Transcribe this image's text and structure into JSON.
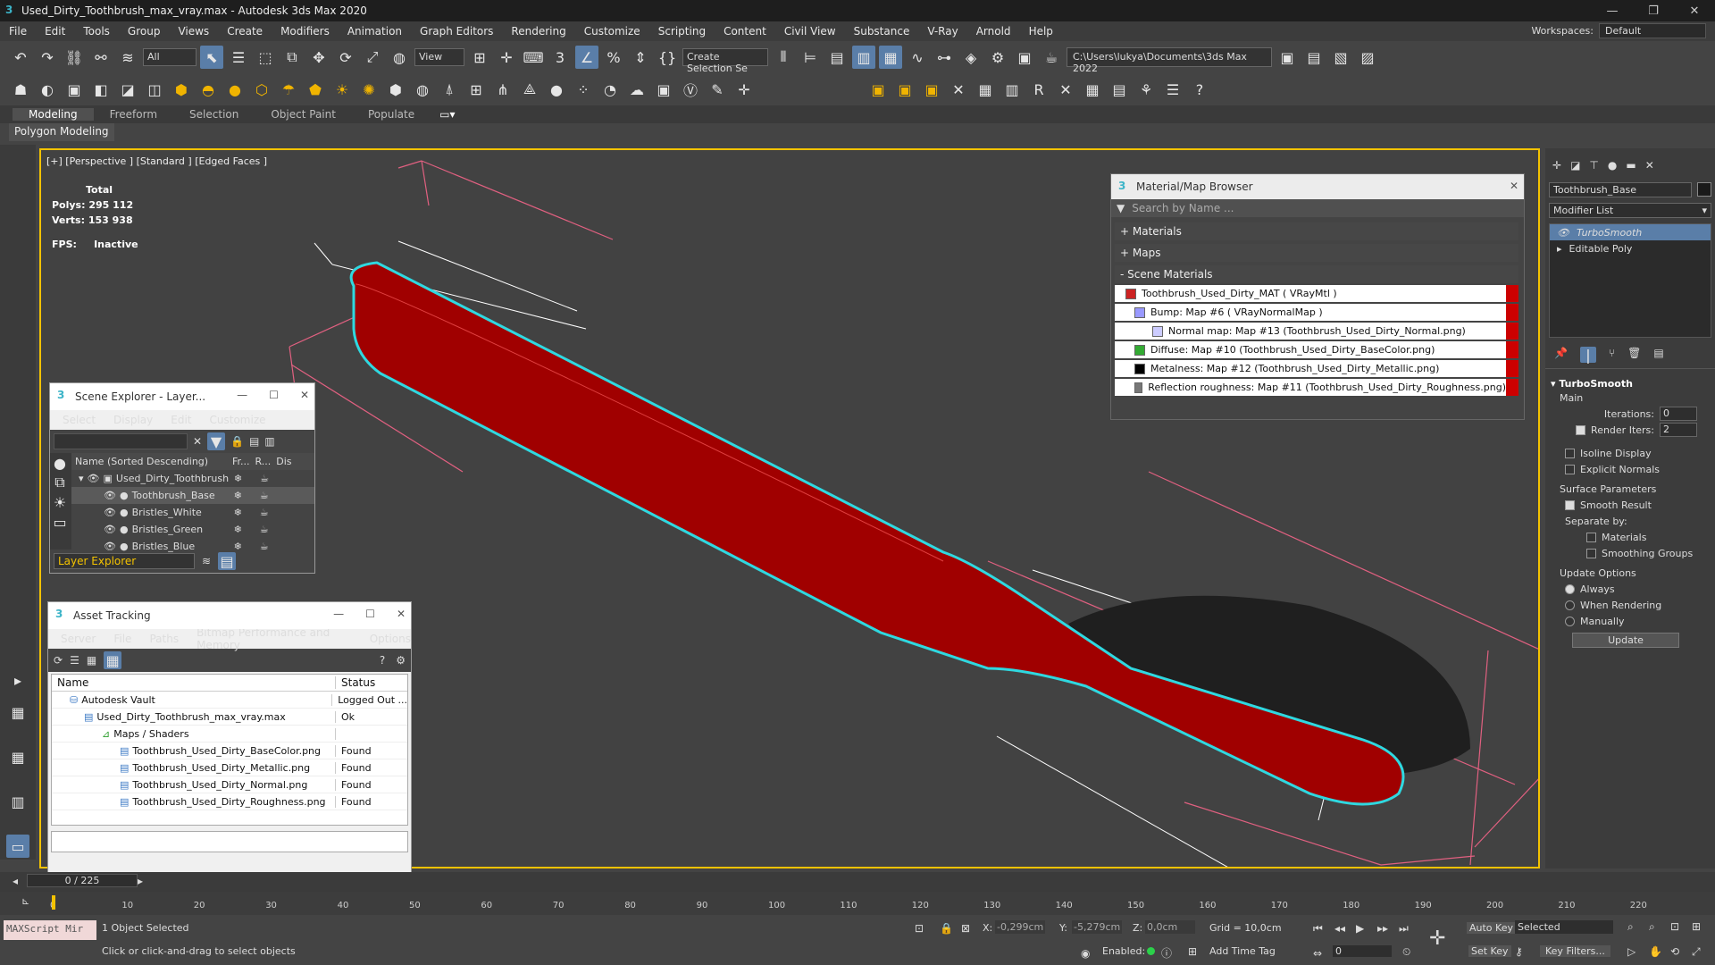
{
  "app": {
    "title": "Used_Dirty_Toothbrush_max_vray.max - Autodesk 3ds Max 2020"
  },
  "menu": [
    "File",
    "Edit",
    "Tools",
    "Group",
    "Views",
    "Create",
    "Modifiers",
    "Animation",
    "Graph Editors",
    "Rendering",
    "Customize",
    "Scripting",
    "Content",
    "Civil View",
    "Substance",
    "V-Ray",
    "Arnold",
    "Help"
  ],
  "workspace": {
    "label": "Workspaces:",
    "value": "Default"
  },
  "toolbar": {
    "filter": "All",
    "view": "View",
    "selection_set": "Create Selection Se",
    "path": "C:\\Users\\lukya\\Documents\\3ds Max 2022"
  },
  "ribbon": {
    "tabs": [
      "Modeling",
      "Freeform",
      "Selection",
      "Object Paint",
      "Populate"
    ],
    "sub": "Polygon Modeling"
  },
  "viewport": {
    "label": "[+] [Perspective ] [Standard ] [Edged Faces ]",
    "total": "Total",
    "polys_label": "Polys:",
    "polys": "295 112",
    "verts_label": "Verts:",
    "verts": "153 938",
    "fps_label": "FPS:",
    "fps": "Inactive"
  },
  "scene_explorer": {
    "title": "Scene Explorer - Layer...",
    "menu": [
      "Select",
      "Display",
      "Edit",
      "Customize"
    ],
    "col_name": "Name (Sorted Descending)",
    "col_fr": "Fr...",
    "col_r": "R...",
    "col_dis": "Dis",
    "items": [
      "Used_Dirty_Toothbrush",
      "Toothbrush_Base",
      "Bristles_White",
      "Bristles_Green",
      "Bristles_Blue"
    ],
    "footer": "Layer Explorer"
  },
  "asset_tracking": {
    "title": "Asset Tracking",
    "menu": [
      "Server",
      "File",
      "Paths",
      "Bitmap Performance and Memory",
      "Options"
    ],
    "col_name": "Name",
    "col_status": "Status",
    "rows": [
      {
        "name": "Autodesk Vault",
        "status": "Logged Out ..."
      },
      {
        "name": "Used_Dirty_Toothbrush_max_vray.max",
        "status": "Ok"
      },
      {
        "name": "Maps / Shaders",
        "status": ""
      },
      {
        "name": "Toothbrush_Used_Dirty_BaseColor.png",
        "status": "Found"
      },
      {
        "name": "Toothbrush_Used_Dirty_Metallic.png",
        "status": "Found"
      },
      {
        "name": "Toothbrush_Used_Dirty_Normal.png",
        "status": "Found"
      },
      {
        "name": "Toothbrush_Used_Dirty_Roughness.png",
        "status": "Found"
      }
    ]
  },
  "material_browser": {
    "title": "Material/Map Browser",
    "search": "Search by Name ...",
    "sections": [
      "+ Materials",
      "+ Maps",
      "- Scene Materials"
    ],
    "items": [
      "Toothbrush_Used_Dirty_MAT ( VRayMtl )",
      "Bump: Map #6  ( VRayNormalMap )",
      "Normal map: Map #13 (Toothbrush_Used_Dirty_Normal.png)",
      "Diffuse: Map #10 (Toothbrush_Used_Dirty_BaseColor.png)",
      "Metalness: Map #12 (Toothbrush_Used_Dirty_Metallic.png)",
      "Reflection roughness: Map #11 (Toothbrush_Used_Dirty_Roughness.png)"
    ]
  },
  "command_panel": {
    "object_name": "Toothbrush_Base",
    "modifier_list": "Modifier List",
    "stack": [
      "TurboSmooth",
      "Editable Poly"
    ],
    "rollout": "TurboSmooth",
    "main": "Main",
    "iterations_label": "Iterations:",
    "iterations": "0",
    "render_iters_label": "Render Iters:",
    "render_iters": "2",
    "isoline": "Isoline Display",
    "explicit_normals": "Explicit Normals",
    "surface_params": "Surface Parameters",
    "smooth_result": "Smooth Result",
    "separate_by": "Separate by:",
    "materials": "Materials",
    "smoothing_groups": "Smoothing Groups",
    "update_options": "Update Options",
    "always": "Always",
    "when_rendering": "When Rendering",
    "manually": "Manually",
    "update": "Update"
  },
  "timeline": {
    "frame": "0 / 225",
    "ticks": [
      "0",
      "10",
      "20",
      "30",
      "40",
      "50",
      "60",
      "70",
      "80",
      "90",
      "100",
      "110",
      "120",
      "130",
      "140",
      "150",
      "160",
      "170",
      "180",
      "190",
      "200",
      "210",
      "220"
    ]
  },
  "status": {
    "maxscript": "MAXScript Mir",
    "selected": "1 Object Selected",
    "hint": "Click or click-and-drag to select objects",
    "x_label": "X:",
    "x": "-0,299cm",
    "y_label": "Y:",
    "y": "-5,279cm",
    "z_label": "Z:",
    "z": "0,0cm",
    "grid": "Grid = 10,0cm",
    "enabled": "Enabled:",
    "add_time_tag": "Add Time Tag",
    "auto_key": "Auto Key",
    "selected_mode": "Selected",
    "set_key": "Set Key",
    "key_filters": "Key Filters...",
    "frame": "0"
  }
}
